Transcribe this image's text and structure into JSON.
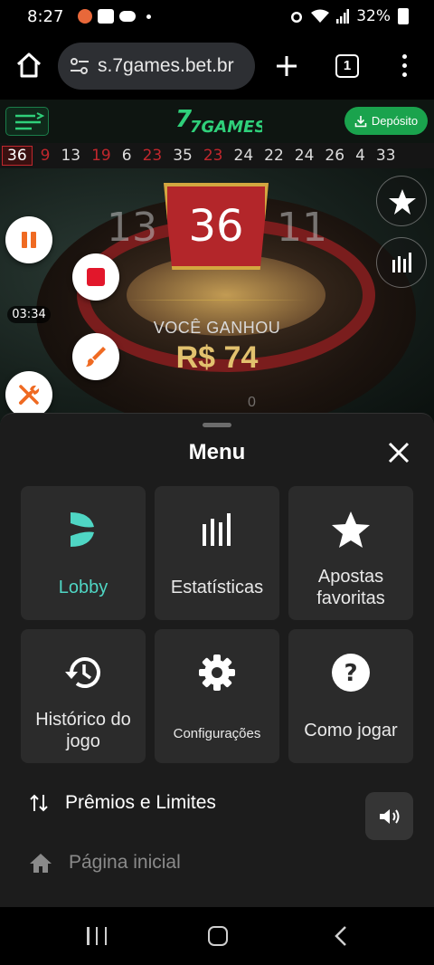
{
  "status_bar": {
    "time": "8:27",
    "battery": "32%"
  },
  "browser": {
    "url": "s.7games.bet.br",
    "tab_count": "1"
  },
  "game_header": {
    "logo_text": "7GAMES",
    "deposit_label": "Depósito"
  },
  "recent_numbers": [
    {
      "n": "36",
      "color": "red"
    },
    {
      "n": "9",
      "color": "red"
    },
    {
      "n": "13",
      "color": "black"
    },
    {
      "n": "19",
      "color": "red"
    },
    {
      "n": "6",
      "color": "black"
    },
    {
      "n": "23",
      "color": "red"
    },
    {
      "n": "35",
      "color": "black"
    },
    {
      "n": "23",
      "color": "red"
    },
    {
      "n": "24",
      "color": "black"
    },
    {
      "n": "22",
      "color": "black"
    },
    {
      "n": "24",
      "color": "black"
    },
    {
      "n": "26",
      "color": "black"
    },
    {
      "n": "4",
      "color": "black"
    },
    {
      "n": "33",
      "color": "black"
    }
  ],
  "result": {
    "number": "36",
    "left_neighbor": "13",
    "right_neighbor": "11",
    "win_label": "VOCÊ GANHOU",
    "win_amount": "R$ 74",
    "zero_label": "0"
  },
  "recorder": {
    "elapsed": "03:34"
  },
  "menu": {
    "title": "Menu",
    "tiles": [
      {
        "label": "Lobby",
        "icon": "lobby-icon"
      },
      {
        "label": "Estatísticas",
        "icon": "stats-bars-icon"
      },
      {
        "label": "Apostas favoritas",
        "icon": "star-icon"
      },
      {
        "label": "Histórico do jogo",
        "icon": "history-icon"
      },
      {
        "label": "Configurações",
        "icon": "gear-icon"
      },
      {
        "label": "Como jogar",
        "icon": "help-icon"
      }
    ],
    "prizes_label": "Prêmios e Limites",
    "home_label": "Página inicial"
  },
  "colors": {
    "accent_green": "#1aa34d",
    "lobby_teal": "#4fd6c4",
    "roulette_red": "#c1272d"
  }
}
